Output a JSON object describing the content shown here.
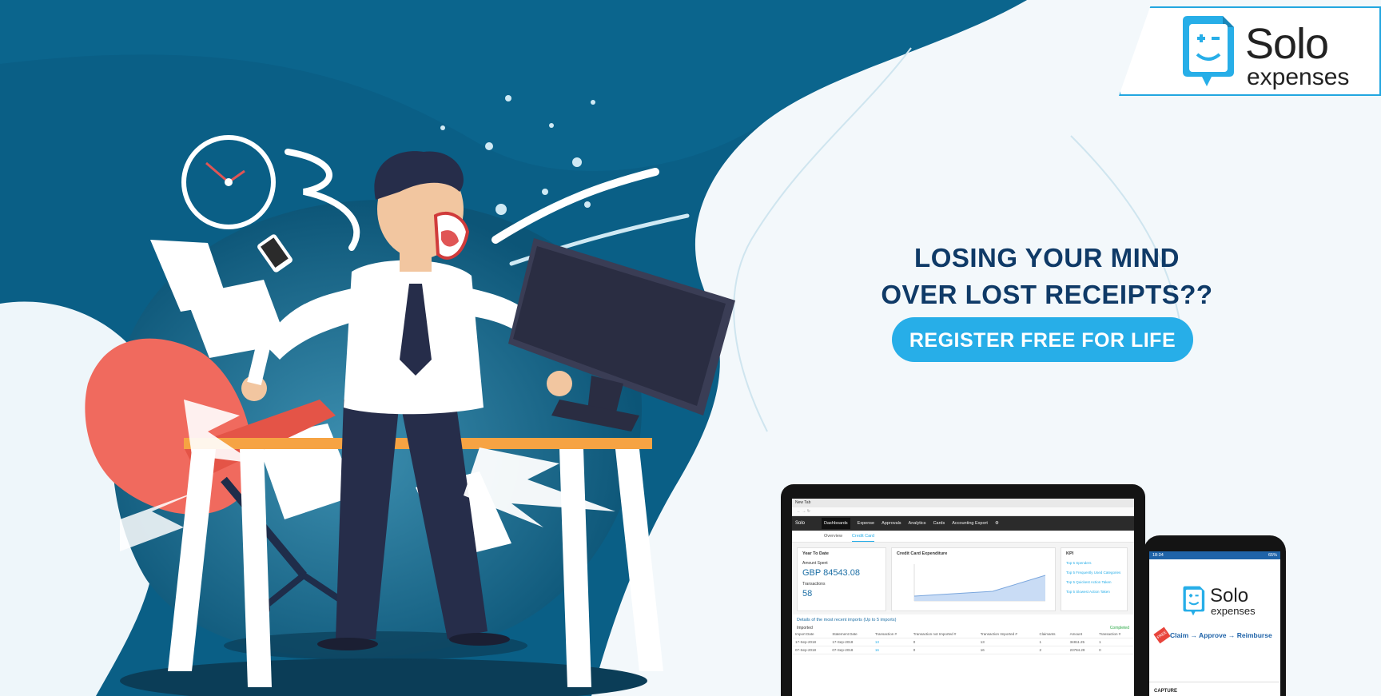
{
  "brand": {
    "name": "Solo",
    "subtitle": "expenses",
    "colors": {
      "accent": "#27aee8",
      "navy": "#0f3a67",
      "teal_dark": "#0c4d6e"
    }
  },
  "hero": {
    "headline_line1": "LOSING YOUR MIND",
    "headline_line2": "OVER LOST RECEIPTS??",
    "cta_label": "REGISTER FREE FOR LIFE"
  },
  "laptop_app": {
    "tab_label": "New Tab",
    "nav_items": [
      "Dashboards",
      "Expense",
      "Approvals",
      "Analytics",
      "Cards",
      "Accounting Export"
    ],
    "active_nav": "Dashboards",
    "subtabs": [
      "Overview",
      "Credit Card"
    ],
    "active_subtab": "Credit Card",
    "year_to_date": {
      "title": "Year To Date",
      "amount_label": "Amount Spent",
      "amount_value": "GBP 84543.08",
      "transactions_label": "Transactions",
      "transactions_value": "58"
    },
    "expenditure_title": "Credit Card Expenditure",
    "kpi": {
      "title": "KPI",
      "links": [
        "Top 5 Spenders",
        "Top 5 Frequently Used Categories",
        "Top 5 Quickest Action Taken",
        "Top 5 Slowest Action Taken"
      ]
    },
    "imports_title": "Details of the most recent imports (Up to 5 imports)",
    "imported_label": "Imported",
    "completed_label": "Completed",
    "table_headers": [
      "Import Date",
      "Statement Date",
      "Transaction #",
      "Transaction not Imported #",
      "Transaction Imported #",
      "Claimants",
      "Amount",
      "Transaction #"
    ],
    "table_rows": [
      [
        "17-Sep-2018",
        "17-Sep-2018",
        "13",
        "0",
        "13",
        "1",
        "34811.25",
        "1"
      ],
      [
        "07-Sep-2018",
        "07-Sep-2018",
        "16",
        "0",
        "16",
        "2",
        "23784.29",
        "0"
      ]
    ]
  },
  "phone_app": {
    "time": "18:34",
    "battery": "65%",
    "logo_name": "Solo",
    "logo_sub": "expenses",
    "tagline": "Claim → Approve → Reimburse",
    "free_badge": "FREE",
    "section_label": "CAPTURE"
  }
}
